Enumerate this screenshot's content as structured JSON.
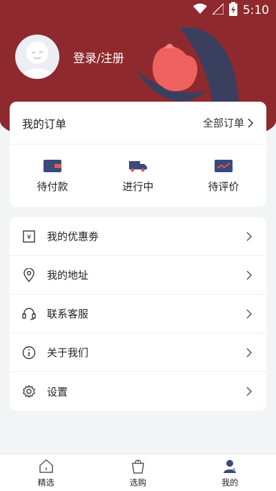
{
  "status_bar": {
    "time": "5:10"
  },
  "profile": {
    "login_label": "登录/注册"
  },
  "orders": {
    "title": "我的订单",
    "all_label": "全部订单",
    "items": [
      {
        "label": "待付款",
        "icon": "wallet-icon"
      },
      {
        "label": "进行中",
        "icon": "delivery-truck-icon"
      },
      {
        "label": "待评价",
        "icon": "review-card-icon"
      }
    ]
  },
  "menu": {
    "items": [
      {
        "label": "我的优惠劵",
        "icon": "coupon-icon"
      },
      {
        "label": "我的地址",
        "icon": "location-pin-icon"
      },
      {
        "label": "联系客服",
        "icon": "headset-icon"
      },
      {
        "label": "关于我们",
        "icon": "info-icon"
      },
      {
        "label": "设置",
        "icon": "gear-icon"
      }
    ]
  },
  "tab_bar": {
    "tabs": [
      {
        "label": "精选",
        "icon": "house-icon"
      },
      {
        "label": "选购",
        "icon": "tulip-bag-icon"
      },
      {
        "label": "我的",
        "icon": "user-icon"
      }
    ],
    "active_tab": "我的"
  },
  "colors": {
    "header": "#8e2a2e",
    "accent_navy": "#3a4a7a",
    "flower": "#f0625f"
  }
}
